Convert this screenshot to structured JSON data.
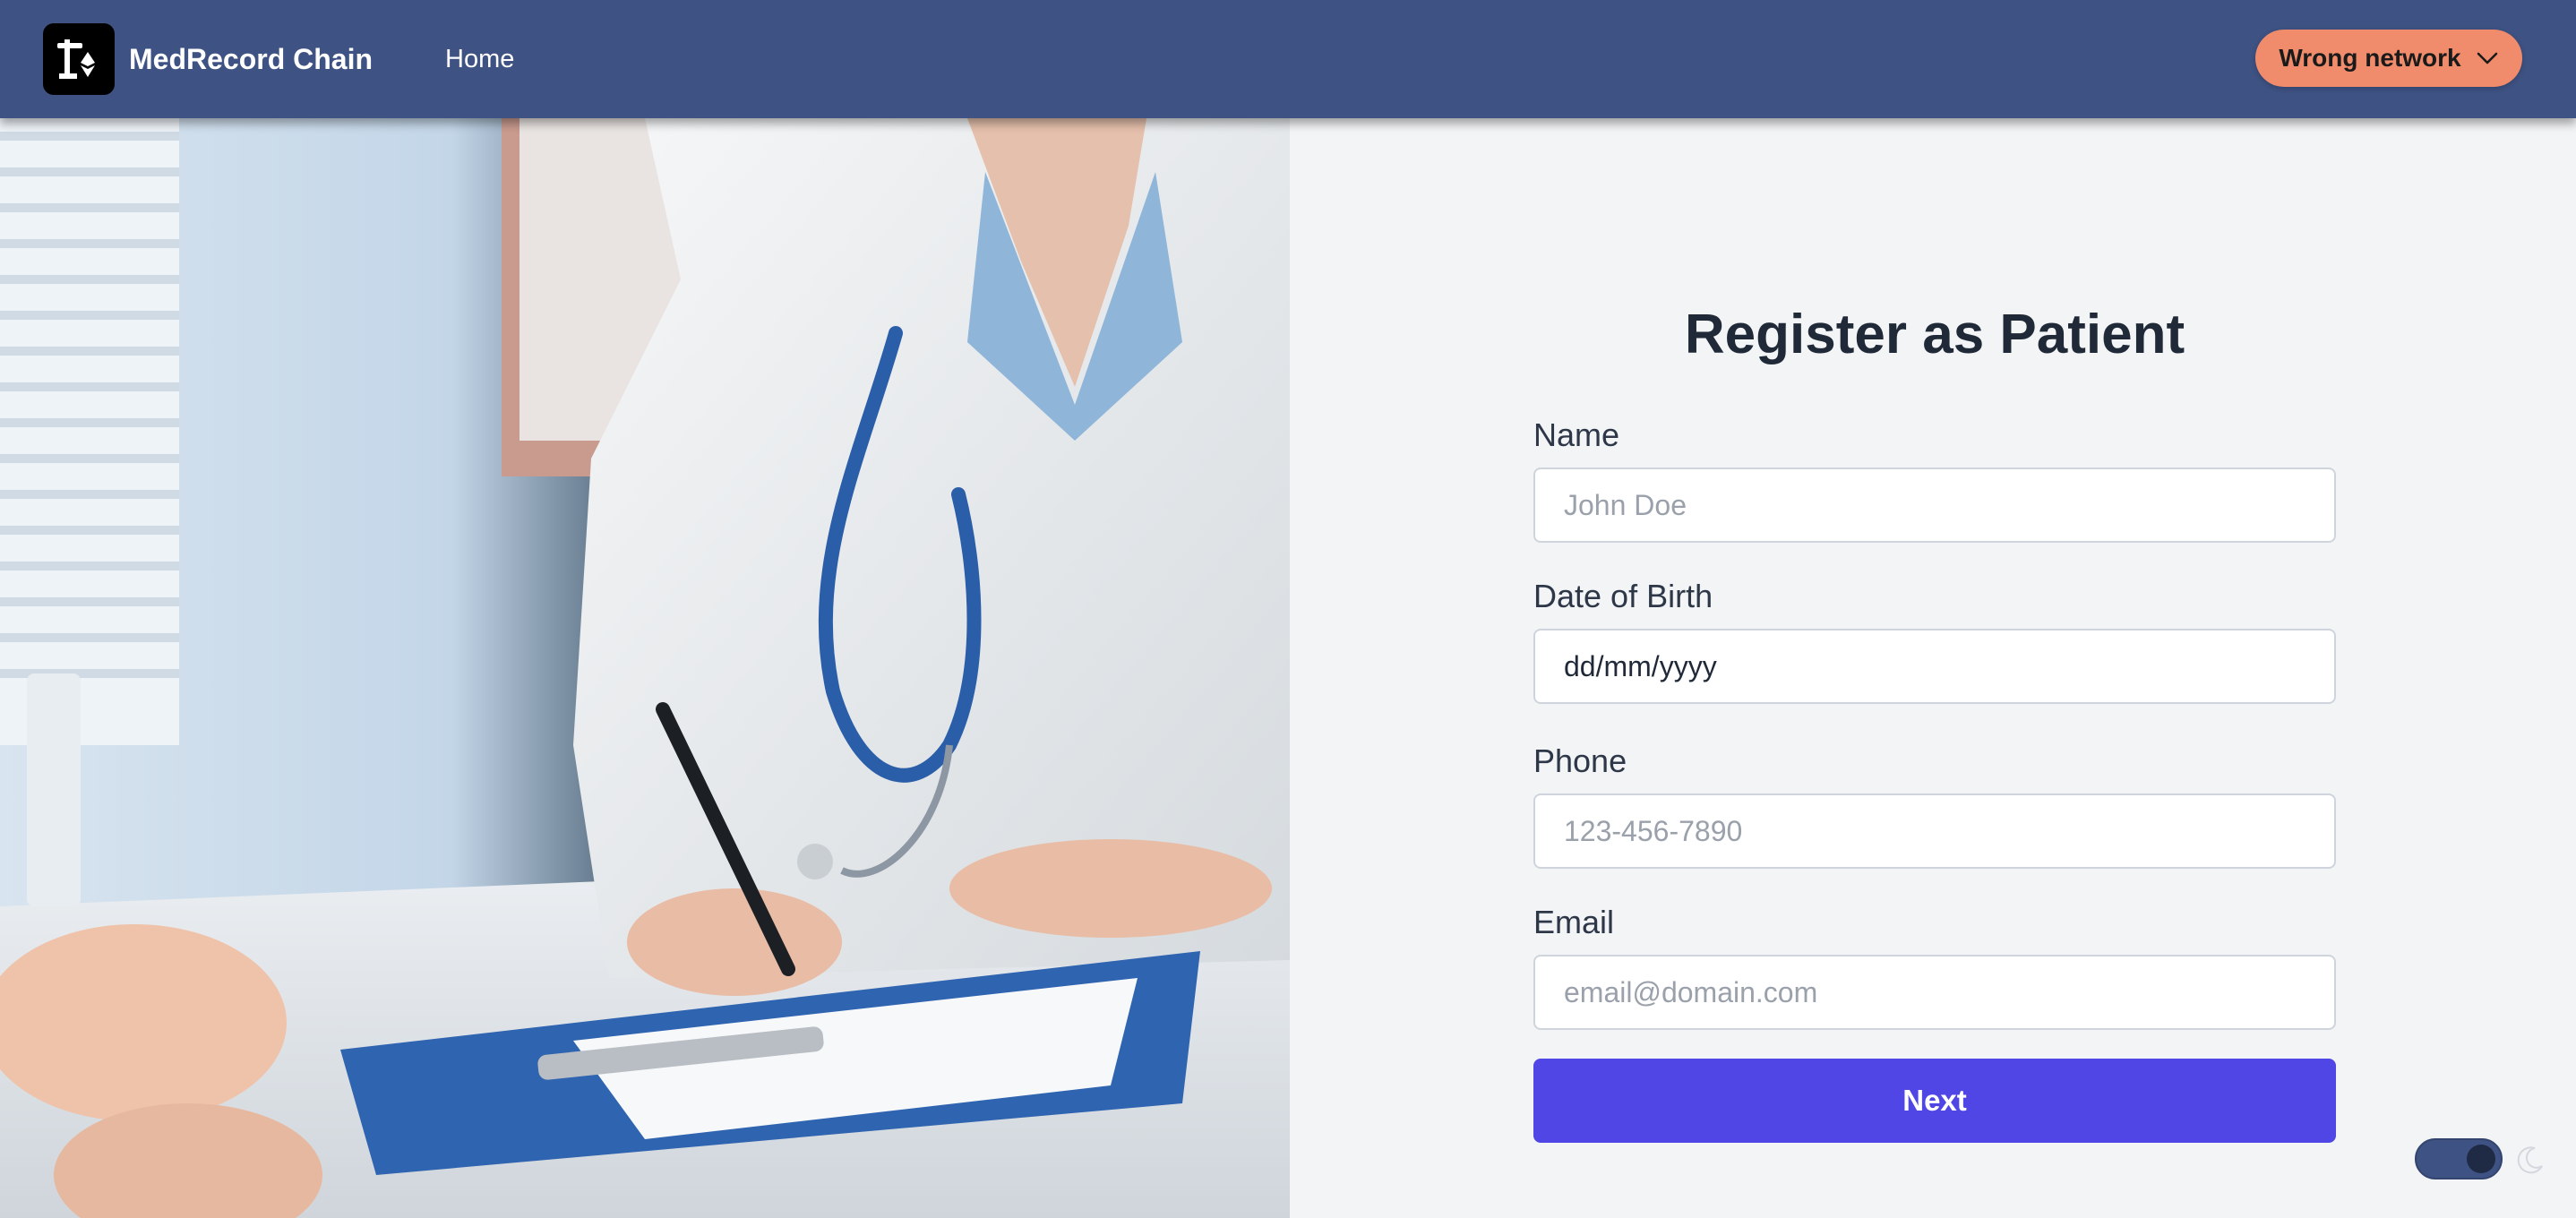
{
  "navbar": {
    "brand": "MedRecord Chain",
    "logo_icon": "scale-ethereum-logo-icon",
    "links": {
      "home": "Home"
    },
    "network_button": {
      "label": "Wrong network",
      "icon": "chevron-down-icon",
      "color": "#f08c6c"
    },
    "background": "#3e5283"
  },
  "hero_image": {
    "description_icon": "doctor-writing-photo"
  },
  "form": {
    "title": "Register as Patient",
    "fields": {
      "name": {
        "label": "Name",
        "placeholder": "John Doe",
        "value": ""
      },
      "dob": {
        "label": "Date of Birth",
        "value": "dd/mm/yyyy"
      },
      "phone": {
        "label": "Phone",
        "placeholder": "123-456-7890",
        "value": ""
      },
      "email": {
        "label": "Email",
        "placeholder": "email@domain.com",
        "value": ""
      }
    },
    "submit_label": "Next",
    "submit_color": "#4f46e5"
  },
  "theme_toggle": {
    "icon": "moon-icon",
    "state": "dark"
  }
}
